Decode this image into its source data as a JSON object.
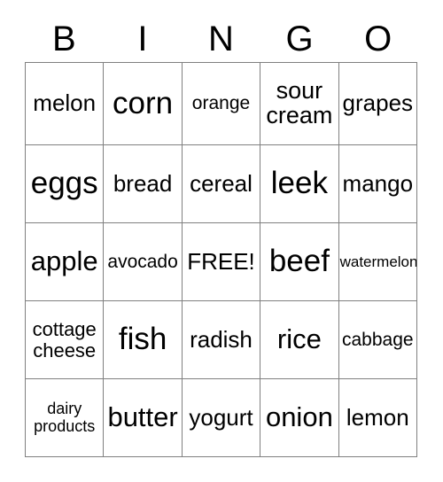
{
  "card": {
    "title": "BINGO",
    "header_letters": [
      "B",
      "I",
      "N",
      "G",
      "O"
    ],
    "free_space_label": "FREE!",
    "border_color": "#808080",
    "text_color": "#000000",
    "background_color": "#ffffff",
    "rows": 5,
    "columns": 5
  },
  "grid": {
    "row1": [
      {
        "label": "melon",
        "size": "s-md"
      },
      {
        "label": "corn",
        "size": "s-xl"
      },
      {
        "label": "orange",
        "size": "s-sm"
      },
      {
        "label": "sour\ncream",
        "size": "s-two-lg"
      },
      {
        "label": "grapes",
        "size": "s-md"
      }
    ],
    "row2": [
      {
        "label": "eggs",
        "size": "s-xl"
      },
      {
        "label": "bread",
        "size": "s-md"
      },
      {
        "label": "cereal",
        "size": "s-md"
      },
      {
        "label": "leek",
        "size": "s-xl"
      },
      {
        "label": "mango",
        "size": "s-md"
      }
    ],
    "row3": [
      {
        "label": "apple",
        "size": "s-lg"
      },
      {
        "label": "avocado",
        "size": "s-sm"
      },
      {
        "label": "FREE!",
        "size": "s-md"
      },
      {
        "label": "beef",
        "size": "s-xl"
      },
      {
        "label": "watermelon",
        "size": "s-xs"
      }
    ],
    "row4": [
      {
        "label": "cottage\ncheese",
        "size": "s-two-md"
      },
      {
        "label": "fish",
        "size": "s-xl"
      },
      {
        "label": "radish",
        "size": "s-md"
      },
      {
        "label": "rice",
        "size": "s-lg"
      },
      {
        "label": "cabbage",
        "size": "s-sm"
      }
    ],
    "row5": [
      {
        "label": "dairy\nproducts",
        "size": "s-two-sm"
      },
      {
        "label": "butter",
        "size": "s-lg"
      },
      {
        "label": "yogurt",
        "size": "s-md"
      },
      {
        "label": "onion",
        "size": "s-lg"
      },
      {
        "label": "lemon",
        "size": "s-md"
      }
    ]
  }
}
